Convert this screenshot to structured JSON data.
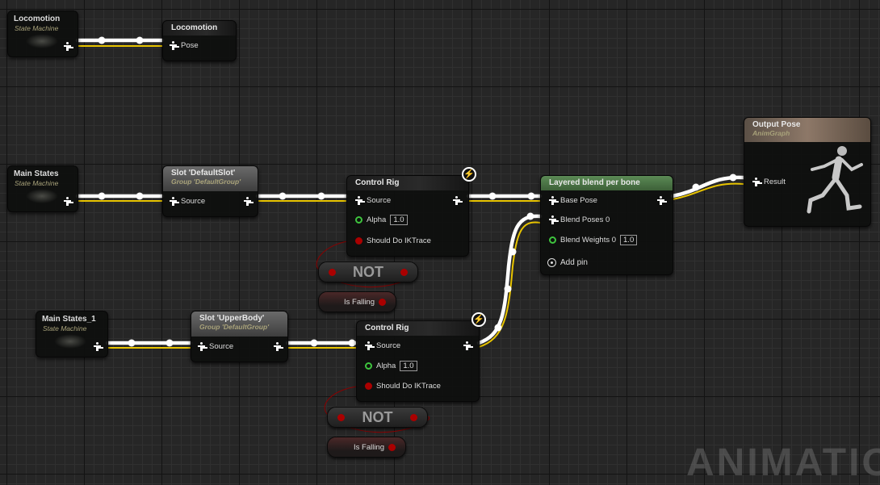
{
  "graph": {
    "watermark": "ANIMATION",
    "nodes": {
      "locomotion_sm": {
        "title": "Locomotion",
        "subtitle": "State Machine"
      },
      "locomotion_pose": {
        "title": "Locomotion",
        "pin": "Pose"
      },
      "main_states": {
        "title": "Main States",
        "subtitle": "State Machine"
      },
      "slot_default": {
        "title": "Slot 'DefaultSlot'",
        "subtitle": "Group 'DefaultGroup'",
        "pin": "Source"
      },
      "control_rig_1": {
        "title": "Control Rig",
        "source": "Source",
        "alpha": "Alpha",
        "alpha_value": "1.0",
        "ik": "Should Do IKTrace"
      },
      "not_1": {
        "title": "NOT"
      },
      "is_falling_1": {
        "title": "Is Falling"
      },
      "layered_blend": {
        "title": "Layered blend per bone",
        "base": "Base Pose",
        "blend": "Blend Poses 0",
        "weights": "Blend Weights 0",
        "weights_value": "1.0",
        "add_pin": "Add pin",
        "header_color": "#4e7a4a"
      },
      "output_pose": {
        "title": "Output Pose",
        "subtitle": "AnimGraph",
        "pin": "Result",
        "header_color": "#6e5e4c"
      },
      "main_states_1": {
        "title": "Main States_1",
        "subtitle": "State Machine"
      },
      "slot_upper": {
        "title": "Slot 'UpperBody'",
        "subtitle": "Group 'DefaultGroup'",
        "pin": "Source"
      },
      "control_rig_2": {
        "title": "Control Rig",
        "source": "Source",
        "alpha": "Alpha",
        "alpha_value": "1.0",
        "ik": "Should Do IKTrace"
      },
      "not_2": {
        "title": "NOT"
      },
      "is_falling_2": {
        "title": "Is Falling"
      }
    },
    "colors": {
      "pose_wire": "#ffffff",
      "pose_wire_shadow": "#e8c400",
      "bool_wire": "#8a0000",
      "float_pin": "#3ec43e",
      "bool_pin": "#aa0000"
    }
  }
}
